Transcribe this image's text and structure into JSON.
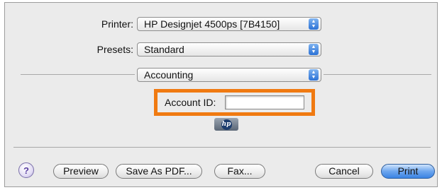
{
  "printer": {
    "label": "Printer:",
    "value": "HP Designjet 4500ps [7B4150]"
  },
  "presets": {
    "label": "Presets:",
    "value": "Standard"
  },
  "panel": {
    "value": "Accounting"
  },
  "account": {
    "label": "Account ID:",
    "value": ""
  },
  "buttons": {
    "help": "?",
    "preview": "Preview",
    "save_pdf": "Save As PDF...",
    "fax": "Fax...",
    "cancel": "Cancel",
    "print": "Print"
  },
  "colors": {
    "highlight": "#f07a11",
    "accent": "#3a83e3"
  },
  "icons": {
    "logo": "hp-logo-icon",
    "popup_arrows": "up-down-arrows-icon"
  }
}
